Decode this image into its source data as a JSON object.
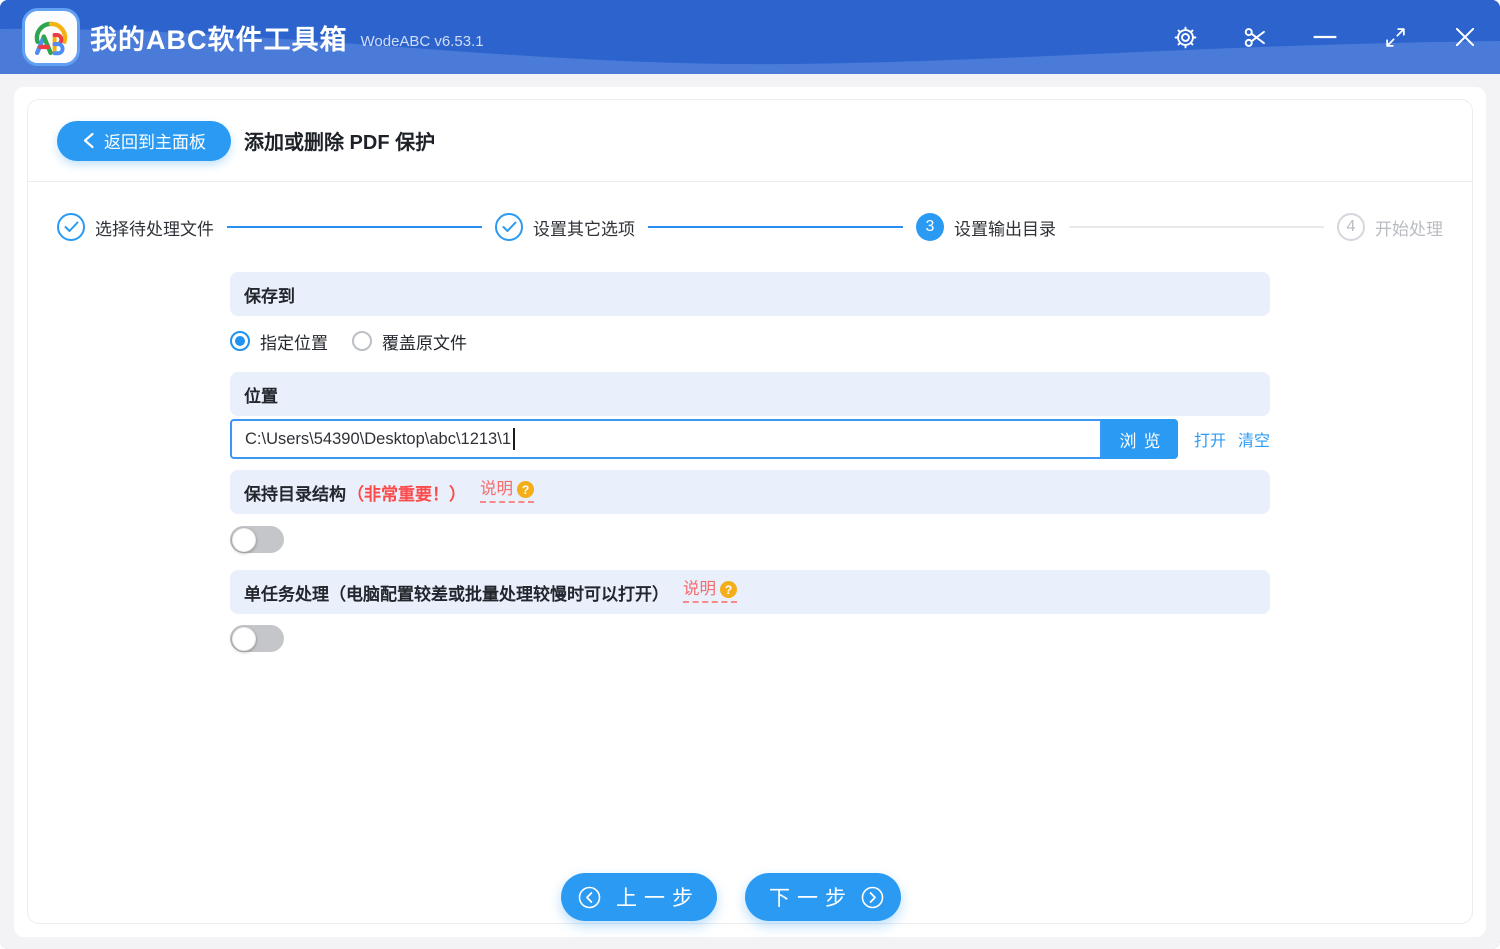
{
  "colors": {
    "accent": "#2b9af3",
    "titlebar_top": "#2c63cd",
    "titlebar_wave": "#4a7bd9",
    "section_bar_bg": "#e9effb",
    "important_red": "#fb4a4a",
    "help_link_red": "#f56c6c",
    "help_badge_orange": "#f3ae19"
  },
  "titlebar": {
    "logo_text": "AB",
    "title": "我的ABC软件工具箱",
    "version": "WodeABC v6.53.1",
    "controls": [
      "settings",
      "screenshot",
      "minimize",
      "maximize",
      "close"
    ]
  },
  "header": {
    "back_label": "返回到主面板",
    "page_title": "添加或删除 PDF 保护"
  },
  "stepper": {
    "steps": [
      {
        "label": "选择待处理文件",
        "state": "done"
      },
      {
        "label": "设置其它选项",
        "state": "done"
      },
      {
        "label": "设置输出目录",
        "state": "active",
        "number": "3"
      },
      {
        "label": "开始处理",
        "state": "pending",
        "number": "4"
      }
    ]
  },
  "sections": {
    "save_to": {
      "title": "保存到",
      "options": [
        {
          "label": "指定位置",
          "selected": true
        },
        {
          "label": "覆盖原文件",
          "selected": false
        }
      ]
    },
    "location": {
      "title": "位置",
      "value": "C:\\Users\\54390\\Desktop\\abc\\1213\\1",
      "browse_label": "浏览",
      "open_label": "打开",
      "clear_label": "清空"
    },
    "keep_structure": {
      "title": "保持目录结构",
      "important": "（非常重要！）",
      "help_label": "说明",
      "help_badge": "?",
      "enabled": false
    },
    "single_task": {
      "title": "单任务处理（电脑配置较差或批量处理较慢时可以打开）",
      "help_label": "说明",
      "help_badge": "?",
      "enabled": false
    }
  },
  "footer": {
    "prev_label": "上一步",
    "next_label": "下一步"
  }
}
